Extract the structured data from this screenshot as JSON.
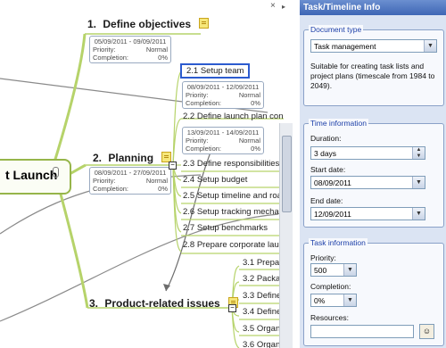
{
  "window": {
    "close_glyph": "×",
    "collapse_glyph": "▸"
  },
  "map": {
    "central": "t Launch",
    "topics": [
      {
        "number": "1.",
        "title": "Define objectives",
        "info": {
          "dates": "05/09/2011 - 09/09/2011",
          "priority_label": "Priority:",
          "priority": "Normal",
          "completion_label": "Completion:",
          "completion": "0%"
        }
      },
      {
        "number": "2.",
        "title": "Planning",
        "info": {
          "dates": "08/09/2011 - 27/09/2011",
          "priority_label": "Priority:",
          "priority": "Normal",
          "completion_label": "Completion:",
          "completion": "0%"
        }
      },
      {
        "number": "3.",
        "title": "Product-related issues"
      }
    ],
    "planning_subs": [
      "2.1  Setup team",
      "2.2  Define launch plan con",
      "2.3  Define responsibilities",
      "2.4  Setup budget",
      "2.5  Setup timeline and road",
      "2.6  Setup tracking mechan",
      "2.7  Setup benchmarks",
      "2.8  Prepare corporate laun"
    ],
    "sub_info_1": {
      "dates": "08/09/2011 - 12/09/2011",
      "priority_label": "Priority:",
      "priority": "Normal",
      "completion_label": "Completion:",
      "completion": "0%"
    },
    "sub_info_2": {
      "dates": "13/09/2011 - 14/09/2011",
      "priority_label": "Priority:",
      "priority": "Normal",
      "completion_label": "Completion:",
      "completion": "0%"
    },
    "product_subs": [
      "3.1  Prepa",
      "3.2  Packa",
      "3.3  Define",
      "3.4  Define",
      "3.5  Organ",
      "3.6  Organ"
    ]
  },
  "pane": {
    "title": "Task/Timeline Info",
    "doc_type": {
      "group_title": "Document type",
      "selected": "Task management",
      "description": "Suitable for creating task lists and project plans (timescale from 1984 to 2049)."
    },
    "time": {
      "group_title": "Time information",
      "duration_label": "Duration:",
      "duration": "3 days",
      "start_label": "Start date:",
      "start": "08/09/2011",
      "end_label": "End date:",
      "end": "12/09/2011"
    },
    "task": {
      "group_title": "Task information",
      "priority_label": "Priority:",
      "priority": "500",
      "completion_label": "Completion:",
      "completion": "0%",
      "resources_label": "Resources:",
      "resources": ""
    }
  },
  "colors": {
    "branch": "#a9c85a",
    "accent": "#2c5bcf",
    "pane_bg": "#dbe4f3"
  }
}
